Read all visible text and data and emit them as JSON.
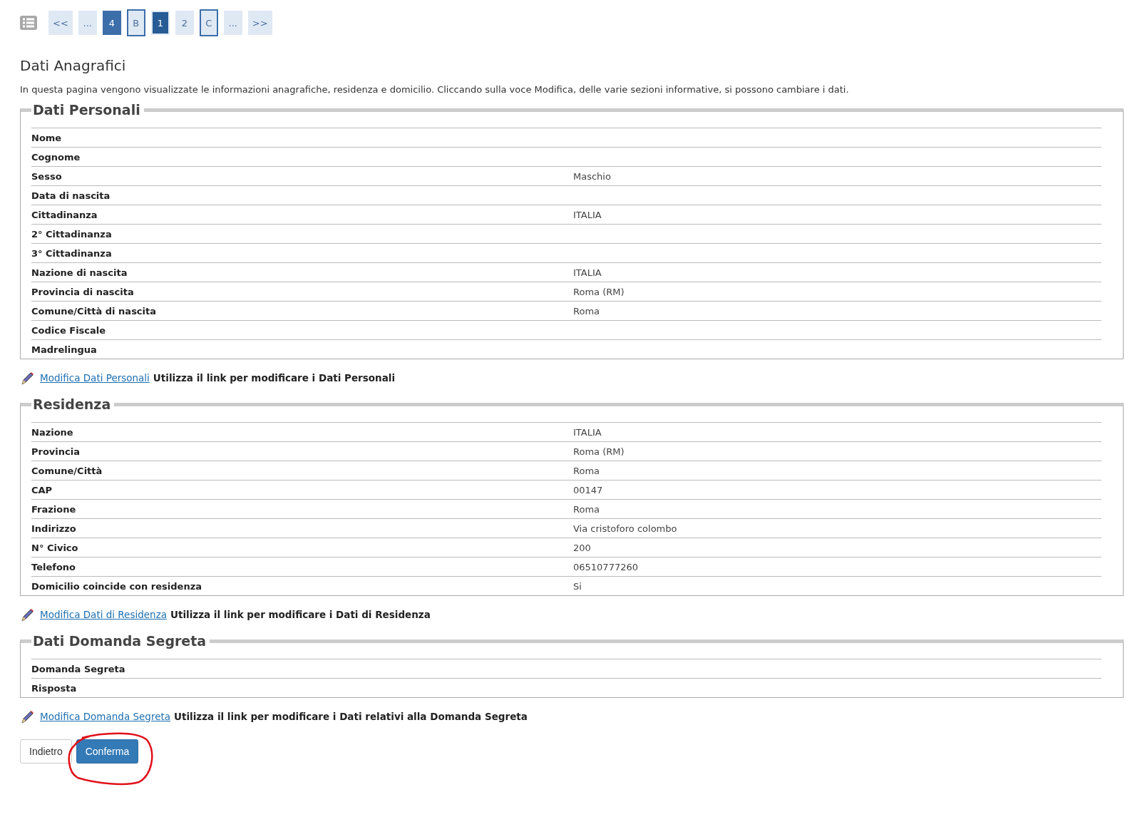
{
  "pagination": [
    {
      "label": "<<",
      "kind": "plain",
      "selected": false
    },
    {
      "label": "...",
      "kind": "plain",
      "selected": false
    },
    {
      "label": "4",
      "kind": "filled",
      "selected": false
    },
    {
      "label": "B",
      "kind": "outlined",
      "selected": false
    },
    {
      "label": "1",
      "kind": "plain",
      "selected": true
    },
    {
      "label": "2",
      "kind": "plain",
      "selected": false
    },
    {
      "label": "C",
      "kind": "outlined",
      "selected": false
    },
    {
      "label": "...",
      "kind": "plain",
      "selected": false
    },
    {
      "label": ">>",
      "kind": "plain",
      "selected": false
    }
  ],
  "title": "Dati Anagrafici",
  "intro": "In questa pagina vengono visualizzate le informazioni anagrafiche, residenza e domicilio. Cliccando sulla voce Modifica, delle varie sezioni informative, si possono cambiare i dati.",
  "sections": [
    {
      "legend": "Dati Personali",
      "rows": [
        {
          "label": "Nome"
        },
        {
          "label": "Cognome"
        },
        {
          "label": "Sesso",
          "value": "Maschio"
        },
        {
          "label": "Data di nascita"
        },
        {
          "label": "Cittadinanza",
          "value": "ITALIA"
        },
        {
          "label": "2° Cittadinanza"
        },
        {
          "label": "3° Cittadinanza"
        },
        {
          "label": "Nazione di nascita",
          "value": "ITALIA"
        },
        {
          "label": "Provincia di nascita",
          "value": "Roma (RM)"
        },
        {
          "label": "Comune/Città di nascita",
          "value": "Roma"
        },
        {
          "label": "Codice Fiscale"
        },
        {
          "label": "Madrelingua"
        }
      ],
      "edit_link": "Modifica Dati Personali",
      "edit_hint": "Utilizza il link per modificare i Dati Personali"
    },
    {
      "legend": "Residenza",
      "rows": [
        {
          "label": "Nazione",
          "value": "ITALIA"
        },
        {
          "label": "Provincia",
          "value": "Roma (RM)"
        },
        {
          "label": "Comune/Città",
          "value": "Roma"
        },
        {
          "label": "CAP",
          "value": "00147"
        },
        {
          "label": "Frazione",
          "value": "Roma"
        },
        {
          "label": "Indirizzo",
          "value": "Via cristoforo colombo"
        },
        {
          "label": "N° Civico",
          "value": "200"
        },
        {
          "label": "Telefono",
          "value": "06510777260"
        },
        {
          "label": "Domicilio coincide con residenza",
          "value": "Si"
        }
      ],
      "edit_link": "Modifica Dati di Residenza",
      "edit_hint": "Utilizza il link per modificare i Dati di Residenza"
    },
    {
      "legend": "Dati Domanda Segreta",
      "rows": [
        {
          "label": "Domanda Segreta"
        },
        {
          "label": "Risposta"
        }
      ],
      "edit_link": "Modifica Domanda Segreta",
      "edit_hint": "Utilizza il link per modificare i Dati relativi alla Domanda Segreta"
    }
  ],
  "buttons": [
    {
      "label": "Indietro",
      "kind": "secondary",
      "circled": false
    },
    {
      "label": "Conferma",
      "kind": "primary",
      "circled": true
    }
  ]
}
